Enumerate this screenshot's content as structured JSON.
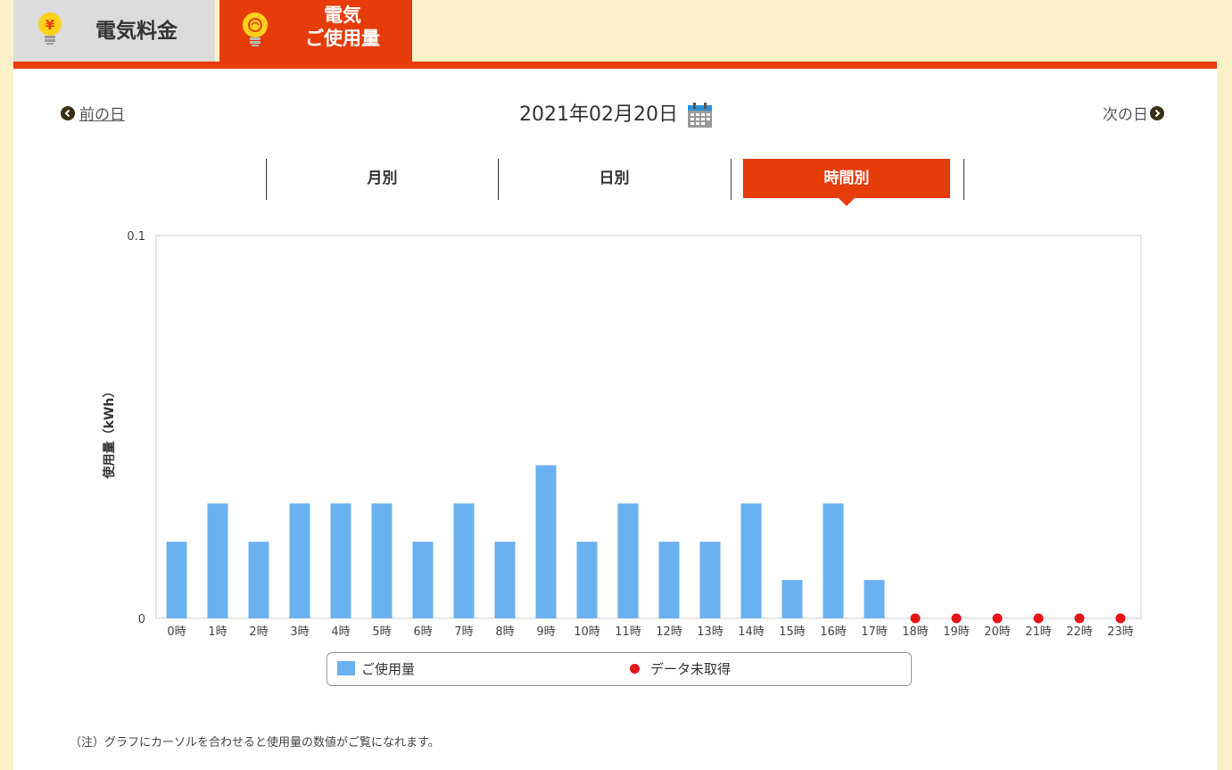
{
  "tabs": {
    "fee_label": "電気料金",
    "usage_label": "電気\nご使用量"
  },
  "day_nav": {
    "prev_label": "前の日",
    "next_label": "次の日",
    "date": "2021年02月20日"
  },
  "period_tabs": {
    "monthly": "月別",
    "daily": "日別",
    "hourly": "時間別",
    "active": "hourly"
  },
  "colors": {
    "accent": "#e63c0a",
    "bar": "#6ab1f0",
    "missing_dot": "#e8141a"
  },
  "chart_data": {
    "type": "bar",
    "categories": [
      "0時",
      "1時",
      "2時",
      "3時",
      "4時",
      "5時",
      "6時",
      "7時",
      "8時",
      "9時",
      "10時",
      "11時",
      "12時",
      "13時",
      "14時",
      "15時",
      "16時",
      "17時",
      "18時",
      "19時",
      "20時",
      "21時",
      "22時",
      "23時"
    ],
    "series": [
      {
        "name": "ご使用量",
        "values": [
          0.02,
          0.03,
          0.02,
          0.03,
          0.03,
          0.03,
          0.02,
          0.03,
          0.02,
          0.04,
          0.02,
          0.03,
          0.02,
          0.02,
          0.03,
          0.01,
          0.03,
          0.01,
          null,
          null,
          null,
          null,
          null,
          null
        ]
      }
    ],
    "missing_data": {
      "name": "データ未取得",
      "categories": [
        "18時",
        "19時",
        "20時",
        "21時",
        "22時",
        "23時"
      ]
    },
    "ylim": [
      0,
      0.1
    ],
    "yticks": [
      "0",
      "0.1"
    ],
    "ylabel": "使用量（kWh）",
    "legend_position": "bottom"
  },
  "note": "（注）グラフにカーソルを合わせると使用量の数値がご覧になれます。"
}
